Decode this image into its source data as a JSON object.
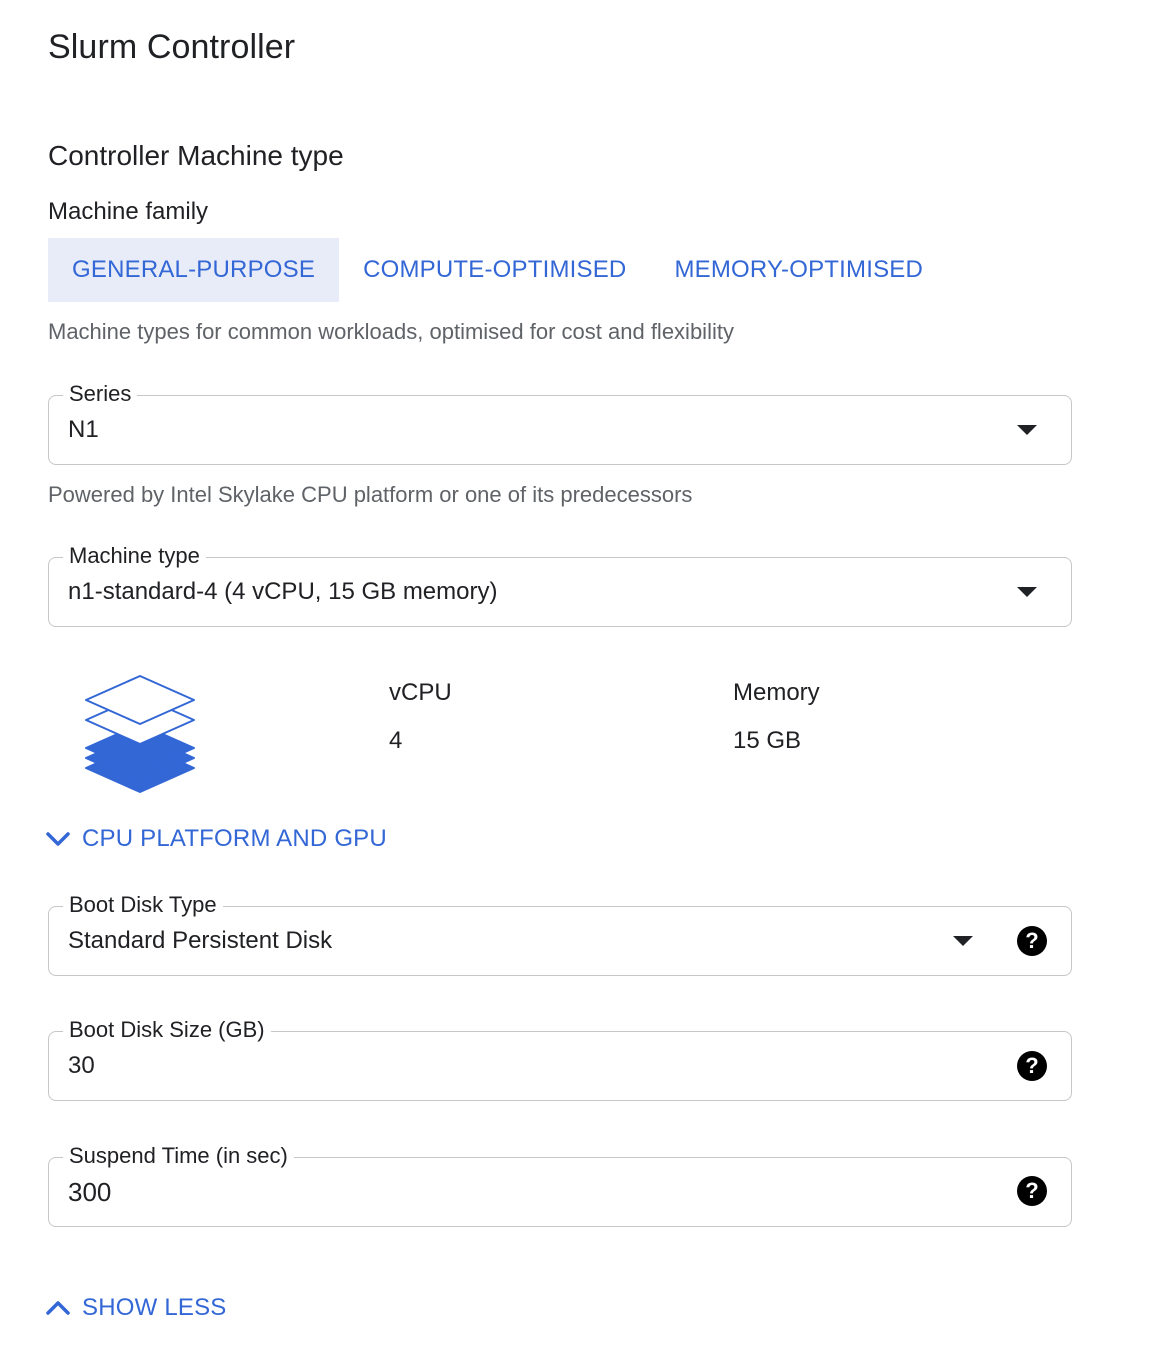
{
  "header": {
    "title": "Slurm Controller"
  },
  "machine_section": {
    "title": "Controller Machine type",
    "family_label": "Machine family",
    "family_tabs": [
      {
        "label": "GENERAL-PURPOSE",
        "selected": true
      },
      {
        "label": "COMPUTE-OPTIMISED",
        "selected": false
      },
      {
        "label": "MEMORY-OPTIMISED",
        "selected": false
      }
    ],
    "family_description": "Machine types for common workloads, optimised for cost and flexibility"
  },
  "series": {
    "label": "Series",
    "value": "N1",
    "helper": "Powered by Intel Skylake CPU platform or one of its predecessors"
  },
  "machine_type": {
    "label": "Machine type",
    "value": "n1-standard-4 (4 vCPU, 15 GB memory)"
  },
  "specs": {
    "icon": "layers-icon",
    "vcpu_label": "vCPU",
    "vcpu_value": "4",
    "memory_label": "Memory",
    "memory_value": "15 GB"
  },
  "cpu_platform_expander": {
    "label": "CPU PLATFORM AND GPU",
    "icon": "chevron-down-icon"
  },
  "boot_disk_type": {
    "label": "Boot Disk Type",
    "value": "Standard Persistent Disk"
  },
  "boot_disk_size": {
    "label": "Boot Disk Size (GB)",
    "value": "30"
  },
  "suspend_time": {
    "label": "Suspend Time (in sec)",
    "value": "300"
  },
  "show_less": {
    "label": "SHOW LESS",
    "icon": "chevron-up-icon"
  },
  "colors": {
    "accent": "#3367d6",
    "selected_tab_bg": "#e8ecf9",
    "border": "#c7c7c7",
    "helper_text": "#5f6368"
  }
}
